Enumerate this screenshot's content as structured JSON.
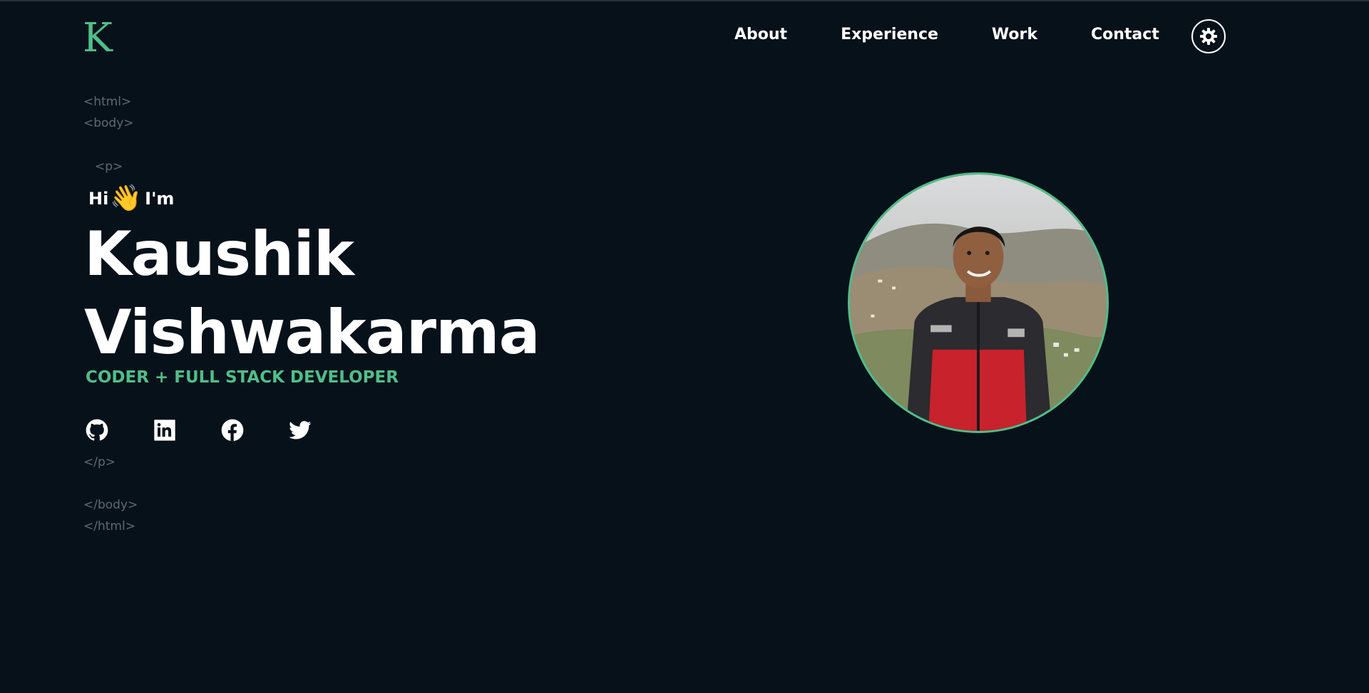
{
  "brand": {
    "logo_letter": "K",
    "accent_color": "#4fbf89"
  },
  "nav": {
    "items": [
      {
        "label": "About"
      },
      {
        "label": "Experience"
      },
      {
        "label": "Work"
      },
      {
        "label": "Contact"
      }
    ],
    "theme_toggle_icon": "gear-sun-icon"
  },
  "code_tags": {
    "html_open": "<html>",
    "body_open": "<body>",
    "p_open": "<p>",
    "p_close": "</p>",
    "body_close": "</body>",
    "html_close": "</html>"
  },
  "hero": {
    "greeting_before": "Hi",
    "greeting_emoji": "👋",
    "greeting_after": "I'm",
    "first_name": "Kaushik",
    "last_name": "Vishwakarma",
    "role": "CODER + FULL STACK DEVELOPER"
  },
  "socials": [
    {
      "icon": "github-icon"
    },
    {
      "icon": "linkedin-icon"
    },
    {
      "icon": "facebook-icon"
    },
    {
      "icon": "twitter-icon"
    }
  ],
  "colors": {
    "background": "#07111a",
    "text": "#ffffff",
    "tag_gray": "#5d6b70"
  }
}
